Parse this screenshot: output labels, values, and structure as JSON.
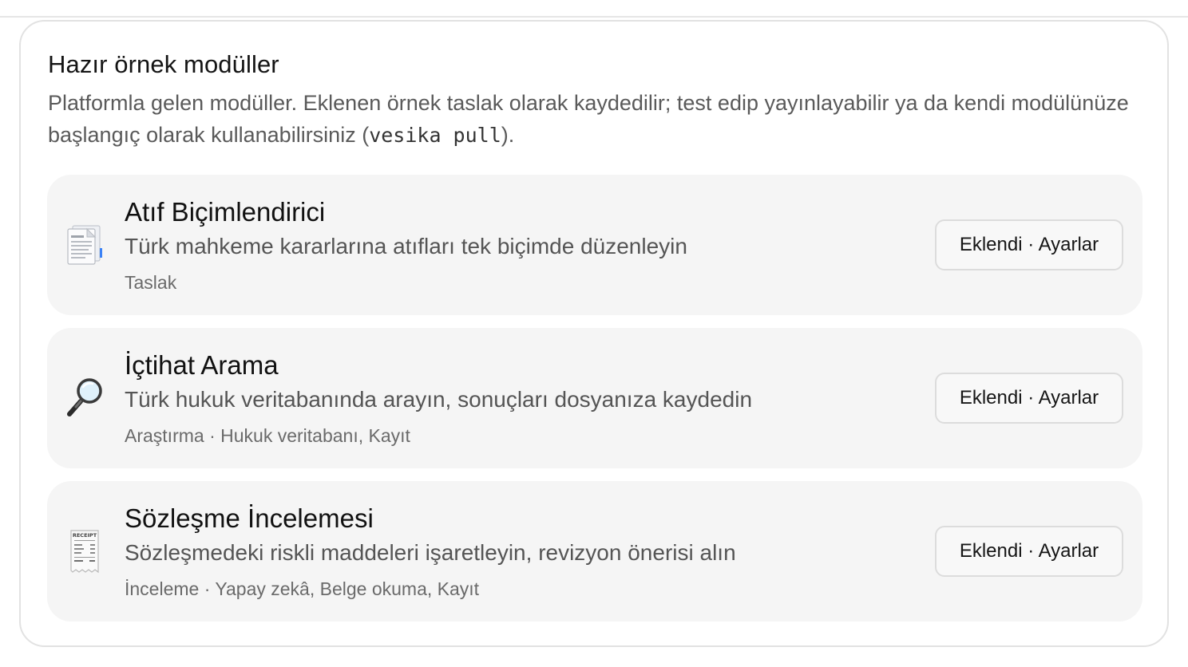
{
  "section": {
    "title": "Hazır örnek modüller",
    "description_lead": "Platformla gelen modüller. Eklenen örnek taslak olarak kaydedilir; test edip yayınlayabilir ya da kendi modülünüze başlangıç olarak kullanabilirsiniz (",
    "description_code": "vesika pull",
    "description_tail": ")."
  },
  "modules": [
    {
      "icon": "document-icon",
      "title": "Atıf Biçimlendirici",
      "description": "Türk mahkeme kararlarına atıfları tek biçimde düzenleyin",
      "meta": "Taslak",
      "button_label": "Eklendi · Ayarlar"
    },
    {
      "icon": "magnifier-icon",
      "title": "İçtihat Arama",
      "description": "Türk hukuk veritabanında arayın, sonuçları dosyanıza kaydedin",
      "meta": "Araştırma · Hukuk veritabanı, Kayıt",
      "button_label": "Eklendi · Ayarlar"
    },
    {
      "icon": "receipt-icon",
      "icon_text": "RECEIPT",
      "title": "Sözleşme İncelemesi",
      "description": "Sözleşmedeki riskli maddeleri işaretleyin, revizyon önerisi alın",
      "meta": "İnceleme · Yapay zekâ, Belge okuma, Kayıt",
      "button_label": "Eklendi · Ayarlar"
    }
  ]
}
